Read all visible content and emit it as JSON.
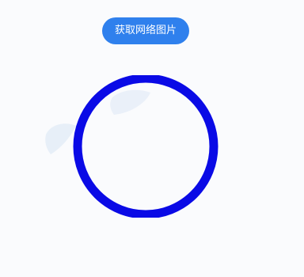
{
  "fetch_button": {
    "label": "获取网络图片"
  },
  "image_display": {
    "ring_icon": "circle-ring-icon",
    "ring_color": "#0a0ae6",
    "ghost_color": "#dfeaf6"
  }
}
